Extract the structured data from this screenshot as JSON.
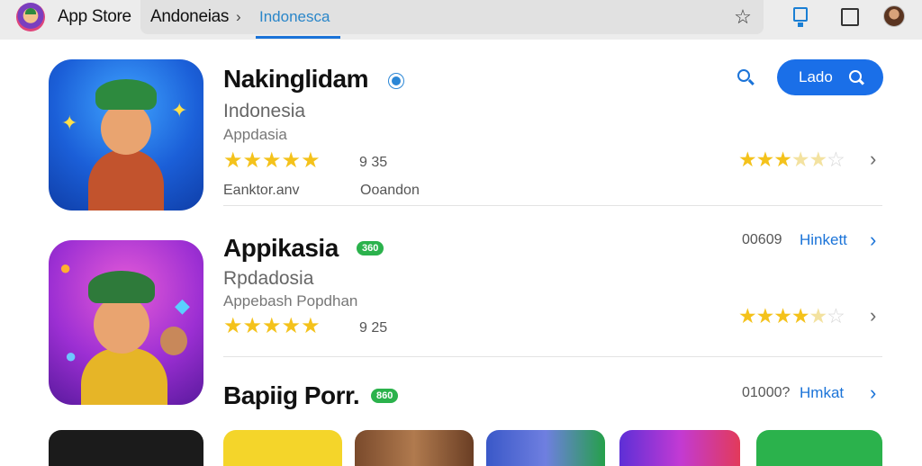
{
  "header": {
    "app_title": "App Store",
    "breadcrumb_label": "Andoneias",
    "breadcrumb_separator": "›",
    "active_tab": "Indonesca"
  },
  "search_button_label": "Lado",
  "apps": [
    {
      "name": "Nakinglidam",
      "subtitle": "Indonesia",
      "category": "Appdasia",
      "stars": "★★★★★",
      "rating": "9 35",
      "meta_left": "Eanktor.anv",
      "meta_right": "Ooandon",
      "right_rating_fraction": 0.65
    },
    {
      "name": "Appikasia",
      "badge": "360",
      "subtitle": "Rpdadosia",
      "category": "Appebash Popdhan",
      "stars": "★★★★★",
      "rating": "9 25",
      "count": "00609",
      "link": "Hinkett",
      "right_rating_fraction": 0.75
    },
    {
      "name": "Bapiig Porr.",
      "badge": "860",
      "count": "01000?",
      "link": "Hmkat"
    }
  ],
  "colors": {
    "accent": "#1a73d8",
    "star": "#f4c21b",
    "badge_green": "#2bb24c"
  }
}
